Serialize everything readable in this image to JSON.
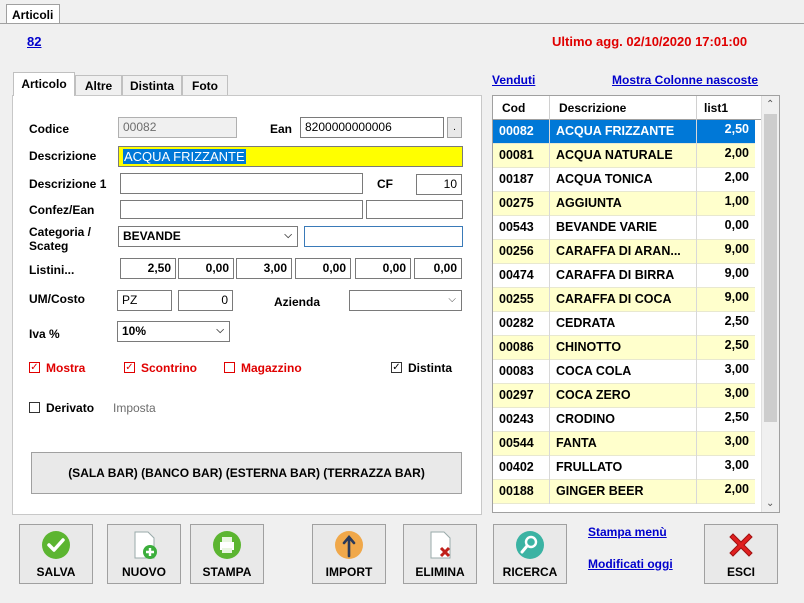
{
  "top_tab": "Articoli",
  "header": {
    "record_link": "82",
    "last_update": "Ultimo agg. 02/10/2020 17:01:00"
  },
  "tabs": [
    "Articolo",
    "Altre",
    "Distinta",
    "Foto"
  ],
  "form": {
    "codice_label": "Codice",
    "codice_value": "00082",
    "ean_label": "Ean",
    "ean_value": "8200000000006",
    "ean_btn": ".",
    "descrizione_label": "Descrizione",
    "descrizione_value": "ACQUA FRIZZANTE",
    "descrizione1_label": "Descrizione 1",
    "descrizione1_value": "",
    "cf_label": "CF",
    "cf_value": "10",
    "confez_label": "Confez/Ean",
    "confez_value": "",
    "confez_ean_value": "",
    "categoria_label_1": "Categoria /",
    "categoria_label_2": "Scateg",
    "categoria_value": "BEVANDE",
    "scateg_value": "",
    "listini_label": "Listini...",
    "listini": [
      "2,50",
      "0,00",
      "3,00",
      "0,00",
      "0,00",
      "0,00"
    ],
    "um_label": "UM/Costo",
    "um_value": "PZ",
    "costo_value": "0",
    "azienda_label": "Azienda",
    "azienda_value": "",
    "iva_label": "Iva %",
    "iva_value": "10%",
    "mostra_label": "Mostra",
    "scontrino_label": "Scontrino",
    "magazzino_label": "Magazzino",
    "distinta_label": "Distinta",
    "derivato_label": "Derivato",
    "imposta_label": "Imposta",
    "reparti": "(SALA BAR) (BANCO BAR) (ESTERNA BAR) (TERRAZZA BAR)"
  },
  "right": {
    "venduti": "Venduti",
    "mostra_colonne": "Mostra Colonne nascoste"
  },
  "grid": {
    "headers": [
      "Cod",
      "Descrizione",
      "list1"
    ],
    "rows": [
      {
        "cod": "00082",
        "desc": "ACQUA FRIZZANTE",
        "price": "2,50"
      },
      {
        "cod": "00081",
        "desc": "ACQUA NATURALE",
        "price": "2,00"
      },
      {
        "cod": "00187",
        "desc": "ACQUA TONICA",
        "price": "2,00"
      },
      {
        "cod": "00275",
        "desc": "AGGIUNTA",
        "price": "1,00"
      },
      {
        "cod": "00543",
        "desc": "BEVANDE VARIE",
        "price": "0,00"
      },
      {
        "cod": "00256",
        "desc": "CARAFFA DI ARAN...",
        "price": "9,00"
      },
      {
        "cod": "00474",
        "desc": "CARAFFA DI BIRRA",
        "price": "9,00"
      },
      {
        "cod": "00255",
        "desc": "CARAFFA DI COCA",
        "price": "9,00"
      },
      {
        "cod": "00282",
        "desc": "CEDRATA",
        "price": "2,50"
      },
      {
        "cod": "00086",
        "desc": "CHINOTTO",
        "price": "2,50"
      },
      {
        "cod": "00083",
        "desc": "COCA COLA",
        "price": "3,00"
      },
      {
        "cod": "00297",
        "desc": "COCA ZERO",
        "price": "3,00"
      },
      {
        "cod": "00243",
        "desc": "CRODINO",
        "price": "2,50"
      },
      {
        "cod": "00544",
        "desc": "FANTA",
        "price": "3,00"
      },
      {
        "cod": "00402",
        "desc": "FRULLATO",
        "price": "3,00"
      },
      {
        "cod": "00188",
        "desc": "GINGER BEER",
        "price": "2,00"
      }
    ]
  },
  "buttons": {
    "salva": "SALVA",
    "nuovo": "NUOVO",
    "stampa": "STAMPA",
    "import": "IMPORT",
    "elimina": "ELIMINA",
    "ricerca": "RICERCA",
    "esci": "ESCI",
    "stampa_menu": "Stampa menù",
    "modificati_oggi": "Modificati oggi"
  },
  "colors": {
    "selection": "#0078d7",
    "highlight": "#ffff00",
    "row_alt": "#ffffcc",
    "link": "#0000cc",
    "alert": "#e00000"
  }
}
